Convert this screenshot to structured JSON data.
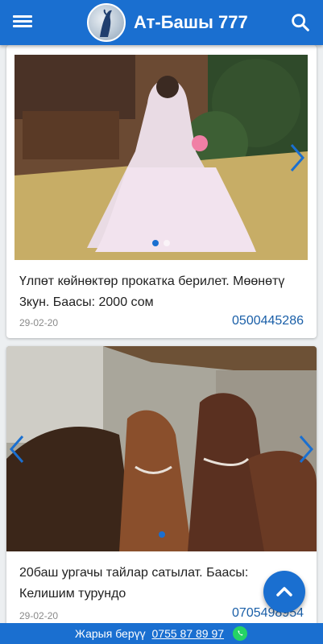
{
  "header": {
    "title": "Ат-Башы 777"
  },
  "listings": [
    {
      "description": "Үлпөт көйнөктөр прокатка берилет. Мөөнөтү 3кун. Баасы: 2000 сом",
      "date": "29-02-20",
      "phone": "0500445286",
      "slides": 2,
      "active_slide": 1
    },
    {
      "description": "20баш ургачы тайлар сатылат. Баасы: Келишим турундо",
      "date": "29-02-20",
      "phone": "0705498954",
      "slides": 1,
      "active_slide": 1
    }
  ],
  "footer": {
    "label": "Жарыя берүү",
    "phone": "0755 87 89 97"
  },
  "colors": {
    "primary": "#1a6fd0",
    "phone_text": "#1a5fa8",
    "whatsapp": "#25d366"
  }
}
